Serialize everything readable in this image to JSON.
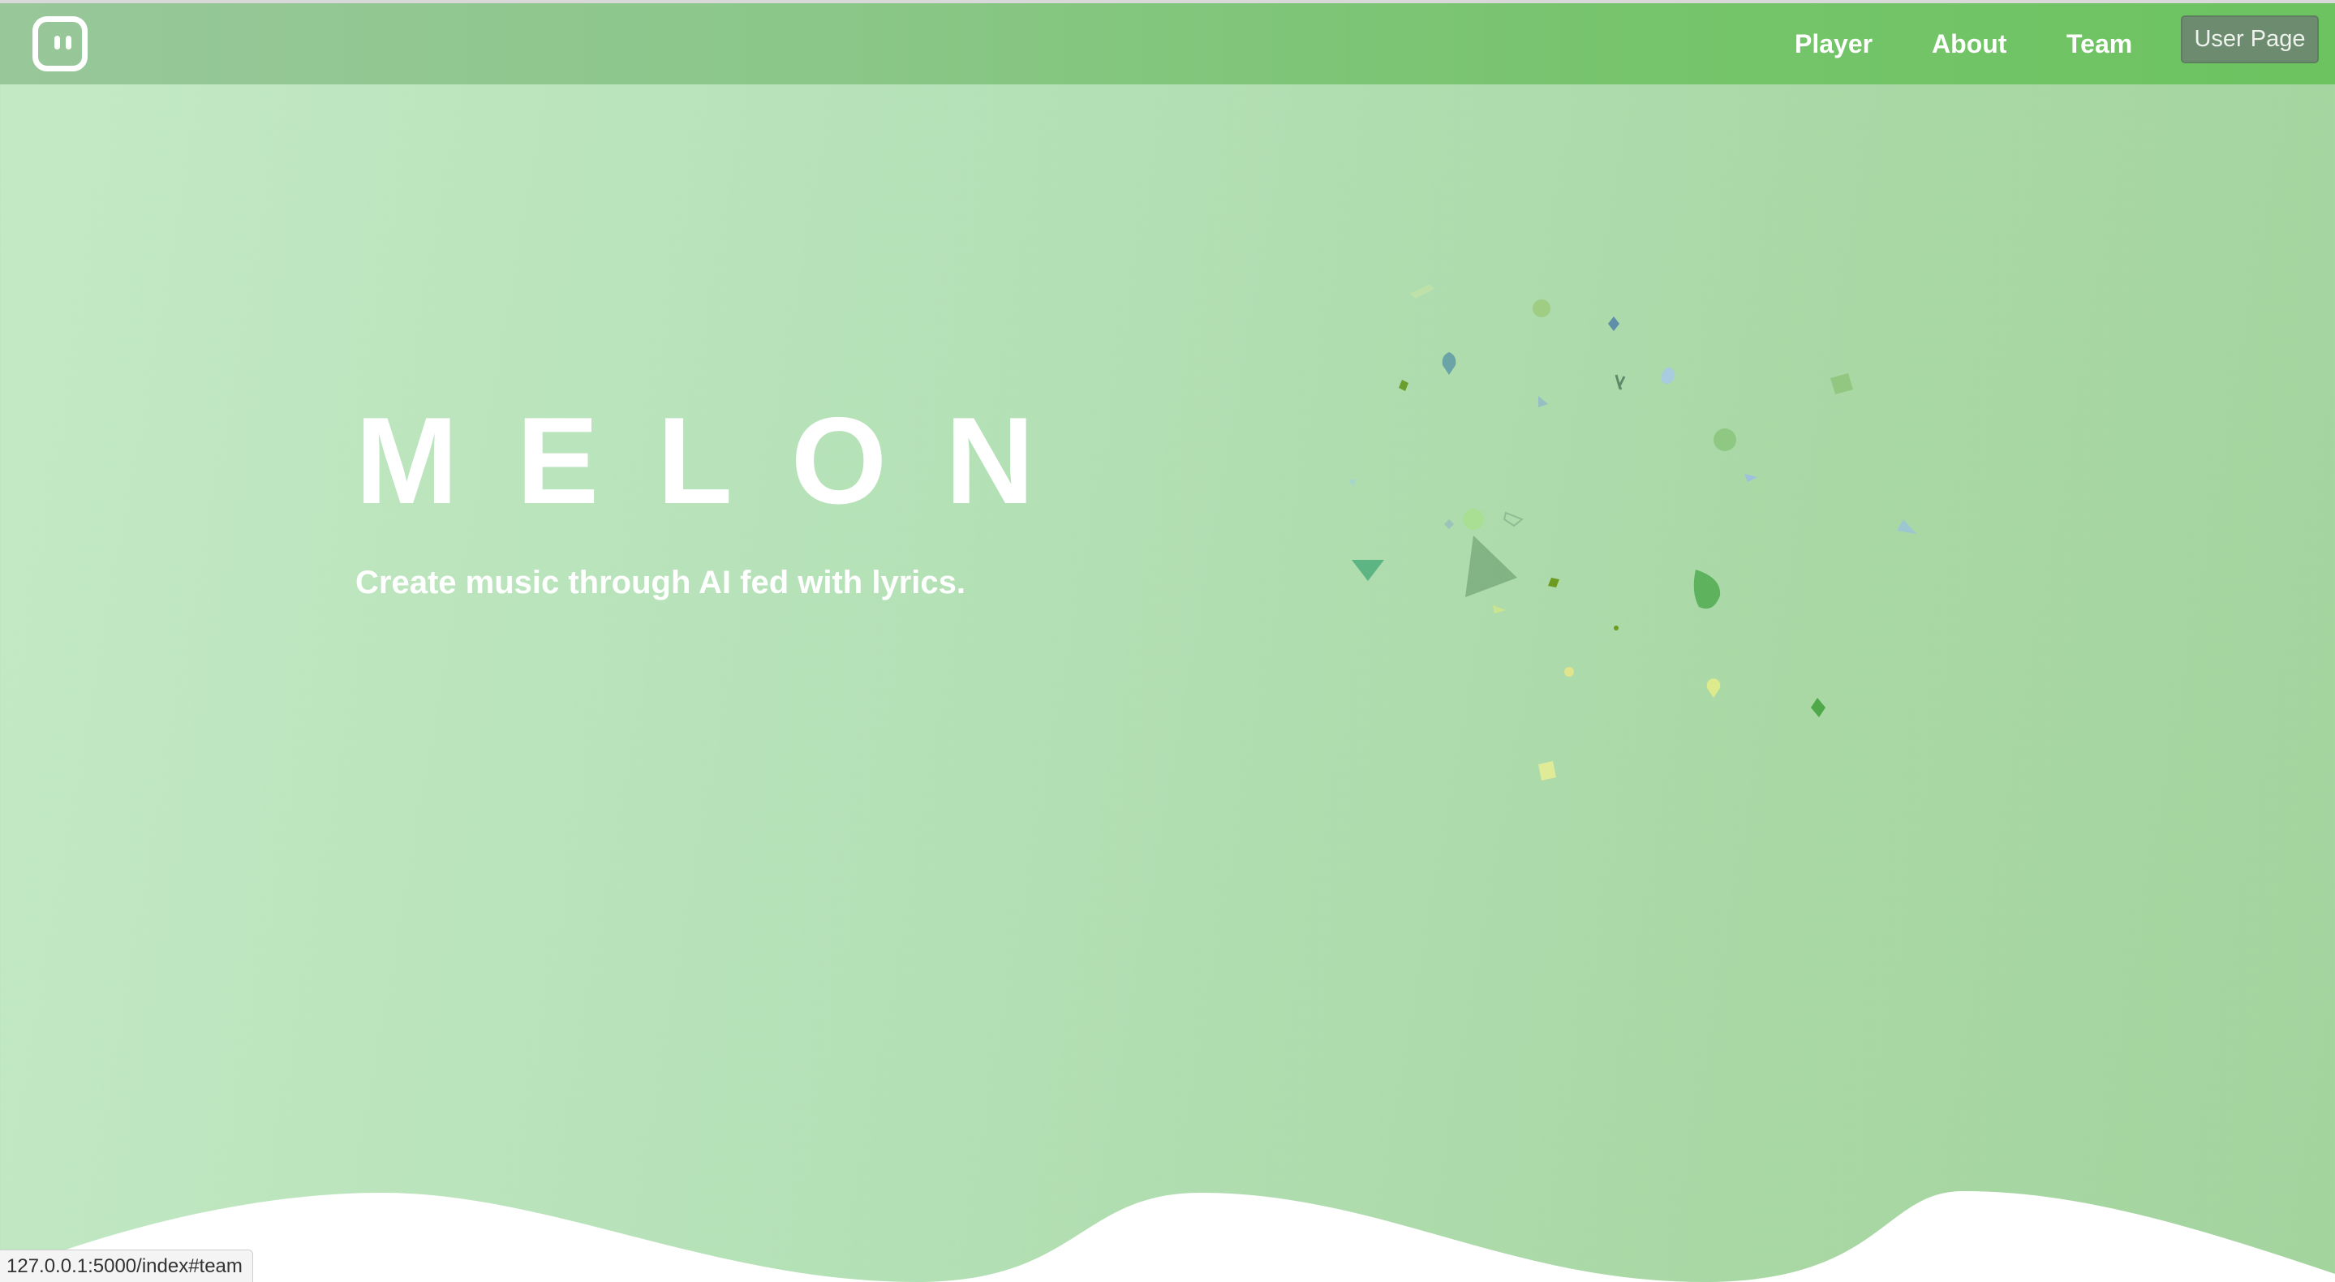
{
  "navbar": {
    "logo_icon": "robot-face-icon",
    "links": [
      {
        "label": "Player"
      },
      {
        "label": "About"
      },
      {
        "label": "Team"
      }
    ],
    "user_button_label": "User Page"
  },
  "hero": {
    "title": "MELON",
    "subtitle": "Create music through AI fed with lyrics."
  },
  "status_bar": {
    "url": "127.0.0.1:5000/index#team"
  },
  "colors": {
    "navbar_start": "#98c79a",
    "navbar_end": "#6cc35f",
    "background": "#b5e1b7",
    "user_button": "#6d8c6f",
    "text": "#ffffff"
  }
}
